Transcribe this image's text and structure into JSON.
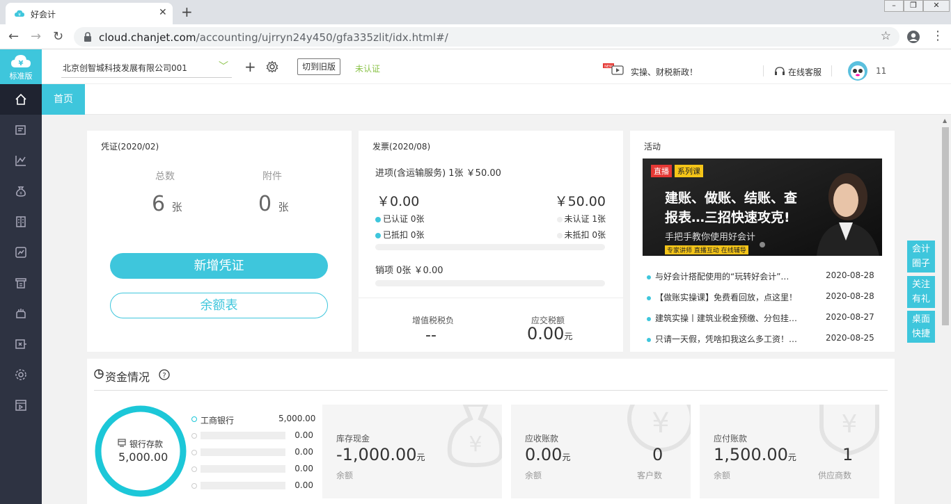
{
  "browser": {
    "tab_title": "好会计",
    "url_host": "cloud.chanjet.com",
    "url_path": "/accounting/ujrryn24y450/gfa335zlit/idx.html#/"
  },
  "sidebar": {
    "logo_label": "标准版",
    "items": [
      "home-icon",
      "voucher-icon",
      "chart-icon",
      "money-icon",
      "ledger-icon",
      "report-icon",
      "invoice-icon",
      "salary-icon",
      "import-icon",
      "settings-icon",
      "media-icon"
    ]
  },
  "topbar": {
    "company": "北京创智城科技发展有限公司001",
    "old_version": "切到旧版",
    "auth_status": "未认证",
    "news": "实操、财税新政！",
    "service": "在线客服",
    "avatar_count": "11"
  },
  "tabs": {
    "home": "首页"
  },
  "voucher": {
    "title": "凭证(2020/02)",
    "total_label": "总数",
    "total_value": "6",
    "attach_label": "附件",
    "attach_value": "0",
    "unit": "张",
    "new_button": "新增凭证",
    "balance_button": "余额表"
  },
  "invoice": {
    "title": "发票(2020/08)",
    "input_line": "进项(含运输服务)  1张  ￥50.00",
    "amount_left": "￥0.00",
    "amount_right": "￥50.00",
    "certified": "已认证  0张",
    "uncertified": "未认证  1张",
    "deducted": "已抵扣  0张",
    "undeducted": "未抵扣  0张",
    "output_line": "销项    0张    ￥0.00",
    "vat_label": "增值税税负",
    "vat_value": "--",
    "tax_label": "应交税额",
    "tax_value": "0.00",
    "tax_unit": "元"
  },
  "activity": {
    "title": "活动",
    "banner_tag": "直播",
    "banner_tag2": "系列课",
    "banner_line1": "建账、做账、结账、查",
    "banner_line2": "报表…三招快速攻克!",
    "banner_line3": "手把手教你使用好会计",
    "banner_line4": "专家讲师 直播互动 在线辅导",
    "items": [
      {
        "text": "与好会计搭配使用的“玩转好会计”…",
        "date": "2020-08-28"
      },
      {
        "text": "【做账实操课】免费看回放，点这里！",
        "date": "2020-08-28"
      },
      {
        "text": "建筑实操丨建筑业税金预缴、分包挂…",
        "date": "2020-08-27"
      },
      {
        "text": "只请一天假，凭啥扣我这么多工资！…",
        "date": "2020-08-25"
      }
    ]
  },
  "funds": {
    "title": "资金情况",
    "bank_label": "银行存款",
    "bank_total": "5,000.00",
    "banks": [
      {
        "name": "工商银行",
        "value": "5,000.00"
      },
      {
        "name": "",
        "value": "0.00"
      },
      {
        "name": "",
        "value": "0.00"
      },
      {
        "name": "",
        "value": "0.00"
      },
      {
        "name": "",
        "value": "0.00"
      }
    ],
    "cash": {
      "label": "库存现金",
      "value": "-1,000.00",
      "unit": "元",
      "sub": "余额"
    },
    "receivable": {
      "label": "应收账款",
      "value": "0.00",
      "unit": "元",
      "sub": "余额",
      "count": "0",
      "count_label": "客户数"
    },
    "payable": {
      "label": "应付账款",
      "value": "1,500.00",
      "unit": "元",
      "sub": "余额",
      "count": "1",
      "count_label": "供应商数"
    }
  },
  "floating": [
    {
      "l1": "会计",
      "l2": "圈子"
    },
    {
      "l1": "关注",
      "l2": "有礼"
    },
    {
      "l1": "桌面",
      "l2": "快捷"
    }
  ],
  "colors": {
    "accent": "#3ec6dc",
    "sidebar": "#2e3342",
    "green": "#8bc34a"
  }
}
